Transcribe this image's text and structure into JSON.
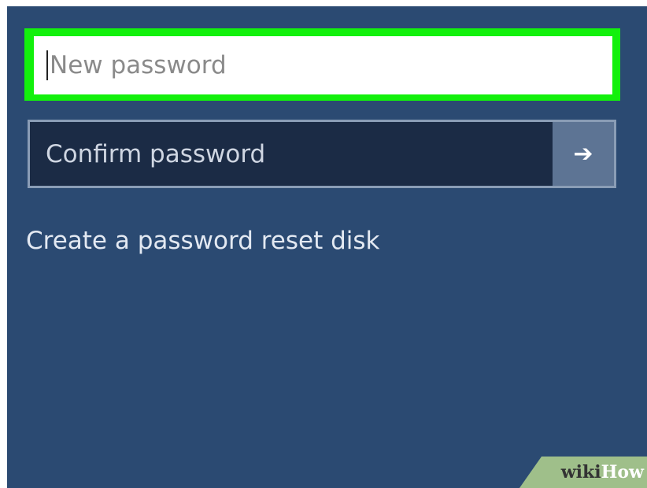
{
  "new_password": {
    "placeholder": "New password",
    "value": "",
    "highlight_color": "#13f00c"
  },
  "confirm_password": {
    "placeholder": "Confirm password",
    "value": "",
    "submit_icon": "arrow-right-icon",
    "submit_glyph": "➔"
  },
  "reset_link": {
    "label": "Create a password reset disk"
  },
  "watermark": {
    "part1": "wiki",
    "part2": "How"
  },
  "colors": {
    "background": "#2b4a72",
    "confirm_field": "#1b2b45",
    "submit_button": "#5d7494"
  }
}
